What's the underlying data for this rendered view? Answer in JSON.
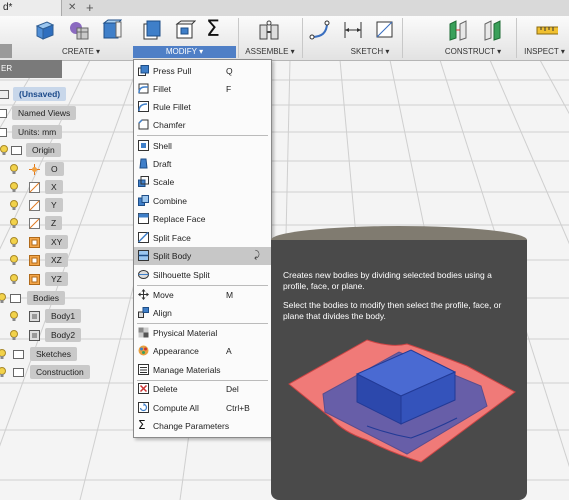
{
  "document": {
    "tab_title": "d*"
  },
  "toolbar": {
    "groups": [
      "CREATE",
      "MODIFY",
      "ASSEMBLE",
      "SKETCH",
      "CONSTRUCT",
      "INSPECT"
    ],
    "modify_icon": "sigma-icon"
  },
  "browser": {
    "header": "ER",
    "items": [
      {
        "label": "(Unsaved)"
      },
      {
        "label": "Named Views"
      },
      {
        "label": "Units: mm"
      },
      {
        "label": "Origin"
      },
      {
        "label": "O"
      },
      {
        "label": "X"
      },
      {
        "label": "Y"
      },
      {
        "label": "Z"
      },
      {
        "label": "XY"
      },
      {
        "label": "XZ"
      },
      {
        "label": "YZ"
      },
      {
        "label": "Bodies"
      },
      {
        "label": "Body1"
      },
      {
        "label": "Body2"
      },
      {
        "label": "Sketches"
      },
      {
        "label": "Construction"
      }
    ]
  },
  "menu": {
    "items": [
      {
        "label": "Press Pull",
        "key": "Q"
      },
      {
        "label": "Fillet",
        "key": "F"
      },
      {
        "label": "Rule Fillet",
        "key": ""
      },
      {
        "label": "Chamfer",
        "key": ""
      },
      {
        "label": "Shell",
        "key": ""
      },
      {
        "label": "Draft",
        "key": ""
      },
      {
        "label": "Scale",
        "key": ""
      },
      {
        "label": "Combine",
        "key": ""
      },
      {
        "label": "Replace Face",
        "key": ""
      },
      {
        "label": "Split Face",
        "key": ""
      },
      {
        "label": "Split Body",
        "key": ""
      },
      {
        "label": "Silhouette Split",
        "key": ""
      },
      {
        "label": "Move",
        "key": "M"
      },
      {
        "label": "Align",
        "key": ""
      },
      {
        "label": "Physical Material",
        "key": ""
      },
      {
        "label": "Appearance",
        "key": "A"
      },
      {
        "label": "Manage Materials",
        "key": ""
      },
      {
        "label": "Delete",
        "key": "Del"
      },
      {
        "label": "Compute All",
        "key": "Ctrl+B"
      },
      {
        "label": "Change Parameters",
        "key": ""
      }
    ]
  },
  "tooltip": {
    "line1": "Creates new bodies by dividing selected bodies using a profile, face, or plane.",
    "line2": "Select the bodies to modify then select the profile, face, or plane that divides the body."
  },
  "colors": {
    "accent": "#4f7fc6",
    "tooltip_bg": "#4a4a4a",
    "tooltip_cap": "#807b70",
    "body_blue": "#3f5fc9",
    "sheet_pink": "#f07a78"
  }
}
